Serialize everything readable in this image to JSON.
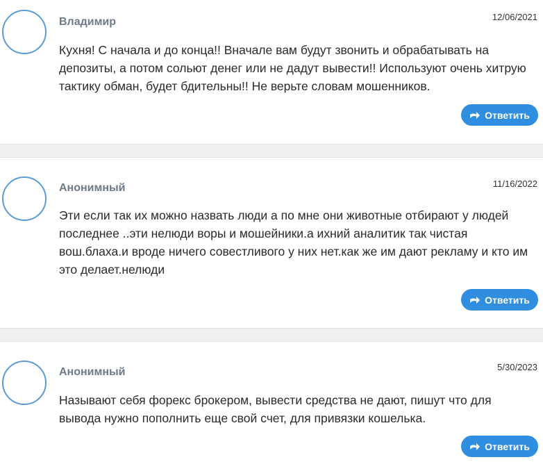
{
  "comments": [
    {
      "author": "Владимир",
      "date": "12/06/2021",
      "text": "Кухня! С начала и до конца!! Вначале вам будут звонить и обрабатывать на депозиты, а потом сольют денег или не дадут вывести!! Используют очень хитрую тактику обман, будет бдительны!! Не верьте словам мошенников.",
      "reply_label": "Ответить"
    },
    {
      "author": "Анонимный",
      "date": "11/16/2022",
      "text": "Эти если так их можно назвать люди а по мне они животные отбирают у людей последнее ..эти нелюди воры и мошейники.а ихний аналитик так чистая вош.блаха.и вроде ничего совестливого у них нет.как же им дают рекламу и кто им это делает.нелюди",
      "reply_label": "Ответить"
    },
    {
      "author": "Анонимный",
      "date": "5/30/2023",
      "text": "Называют себя форекс брокером, вывести средства не дают, пишут что для вывода нужно пополнить еще свой счет, для привязки кошелька.",
      "reply_label": "Ответить"
    }
  ],
  "colors": {
    "accent": "#2f8ee0",
    "avatar_border": "#5b9bd5",
    "author": "#6f7a86",
    "separator": "#f0f0f0"
  },
  "icons": {
    "reply": "reply-arrow-icon"
  }
}
